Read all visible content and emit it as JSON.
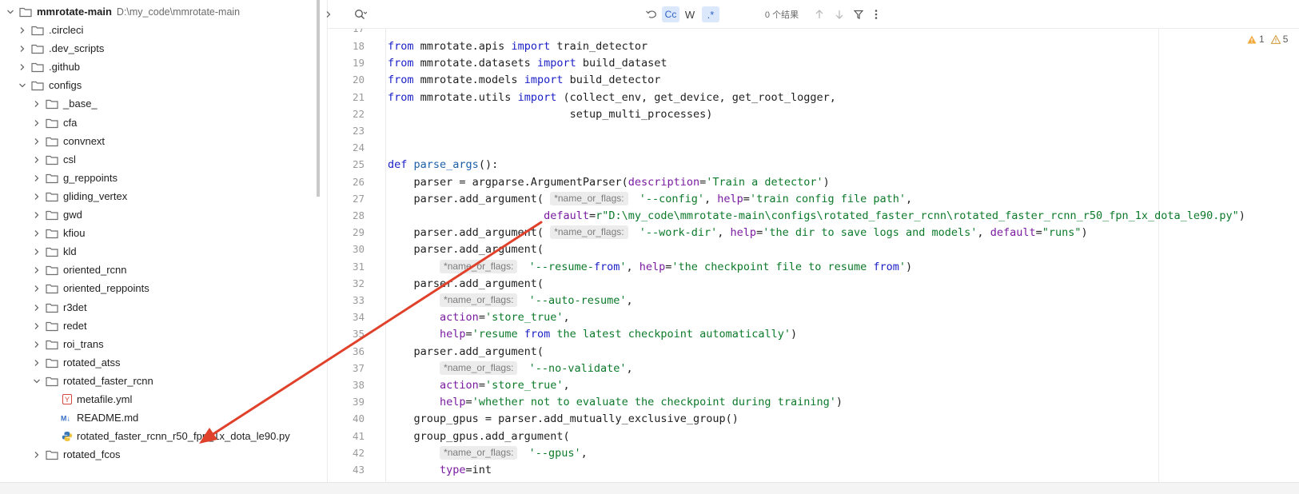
{
  "project": {
    "root": {
      "name": "mmrotate-main",
      "path": "D:\\my_code\\mmrotate-main"
    },
    "top_folders": [
      ".circleci",
      ".dev_scripts",
      ".github"
    ],
    "configs_label": "configs",
    "config_folders": [
      "_base_",
      "cfa",
      "convnext",
      "csl",
      "g_reppoints",
      "gliding_vertex",
      "gwd",
      "kfiou",
      "kld",
      "oriented_rcnn",
      "oriented_reppoints",
      "r3det",
      "redet",
      "roi_trans",
      "rotated_atss"
    ],
    "open_folder": "rotated_faster_rcnn",
    "files": [
      {
        "name": "metafile.yml",
        "icon": "yaml-icon"
      },
      {
        "name": "README.md",
        "icon": "markdown-icon"
      },
      {
        "name": "rotated_faster_rcnn_r50_fpn_1x_dota_le90.py",
        "icon": "python-icon"
      }
    ],
    "after_folder": "rotated_fcos"
  },
  "find": {
    "match_case_label": "Cc",
    "words_label": "W",
    "regex_label": ".*",
    "result_count": "0 个结果"
  },
  "inspections": {
    "warnings_a": "1",
    "warnings_b": "5"
  },
  "editor": {
    "first_line_partial": "17",
    "lines": [
      {
        "n": "18",
        "text": "from mmrotate.apis import train_detector"
      },
      {
        "n": "19",
        "text": "from mmrotate.datasets import build_dataset"
      },
      {
        "n": "20",
        "text": "from mmrotate.models import build_detector"
      },
      {
        "n": "21",
        "text": "from mmrotate.utils import (collect_env, get_device, get_root_logger,"
      },
      {
        "n": "22",
        "text": "                            setup_multi_processes)"
      },
      {
        "n": "23",
        "text": ""
      },
      {
        "n": "24",
        "text": ""
      },
      {
        "n": "25",
        "text": "def parse_args():"
      },
      {
        "n": "26",
        "text": "    parser = argparse.ArgumentParser(description='Train a detector')"
      },
      {
        "n": "27",
        "text": "    parser.add_argument( *name_or_flags: '--config', help='train config file path',"
      },
      {
        "n": "28",
        "text": "                        default=r\"D:\\my_code\\mmrotate-main\\configs\\rotated_faster_rcnn\\rotated_faster_rcnn_r50_fpn_1x_dota_le90.py\")"
      },
      {
        "n": "29",
        "text": "    parser.add_argument( *name_or_flags: '--work-dir', help='the dir to save logs and models', default=\"runs\")"
      },
      {
        "n": "30",
        "text": "    parser.add_argument("
      },
      {
        "n": "31",
        "text": "        *name_or_flags: '--resume-from', help='the checkpoint file to resume from')"
      },
      {
        "n": "32",
        "text": "    parser.add_argument("
      },
      {
        "n": "33",
        "text": "        *name_or_flags: '--auto-resume',"
      },
      {
        "n": "34",
        "text": "        action='store_true',"
      },
      {
        "n": "35",
        "text": "        help='resume from the latest checkpoint automatically')"
      },
      {
        "n": "36",
        "text": "    parser.add_argument("
      },
      {
        "n": "37",
        "text": "        *name_or_flags: '--no-validate',"
      },
      {
        "n": "38",
        "text": "        action='store_true',"
      },
      {
        "n": "39",
        "text": "        help='whether not to evaluate the checkpoint during training')"
      },
      {
        "n": "40",
        "text": "    group_gpus = parser.add_mutually_exclusive_group()"
      },
      {
        "n": "41",
        "text": "    group_gpus.add_argument("
      },
      {
        "n": "42",
        "text": "        *name_or_flags: '--gpus',"
      },
      {
        "n": "43",
        "text": "        type=int"
      }
    ]
  },
  "colors": {
    "arrow": "#e0412b",
    "keyword": "#1a1fc6",
    "string": "#0c7a2a",
    "param": "#7a1ba0"
  }
}
